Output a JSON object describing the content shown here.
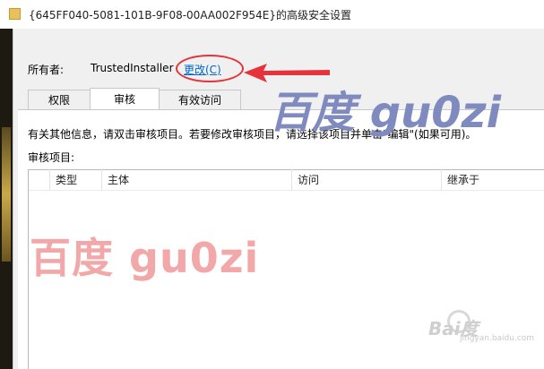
{
  "window": {
    "title": "{645FF040-5081-101B-9F08-00AA002F954E}的高级安全设置"
  },
  "owner": {
    "label": "所有者:",
    "value": "TrustedInstaller",
    "change_link": "更改(C)"
  },
  "tabs": [
    {
      "label": "权限",
      "active": false
    },
    {
      "label": "审核",
      "active": true
    },
    {
      "label": "有效访问",
      "active": false
    }
  ],
  "audit": {
    "info_text": "有关其他信息，请双击审核项目。若要修改审核项目，请选择该项目并单击\"编辑\"(如果可用)。",
    "entries_label": "审核项目:",
    "columns": [
      "类型",
      "主体",
      "访问",
      "继承于"
    ],
    "rows": []
  },
  "watermarks": {
    "large_text": "百度  gu0zi",
    "script_text": "百度 gu0zi",
    "baidu_logo": "Bai度",
    "site": "jingyan.baidu.com"
  },
  "colors": {
    "link": "#0066cc",
    "annotation_red": "#e5323b",
    "window_bg": "#f0f0f0"
  }
}
